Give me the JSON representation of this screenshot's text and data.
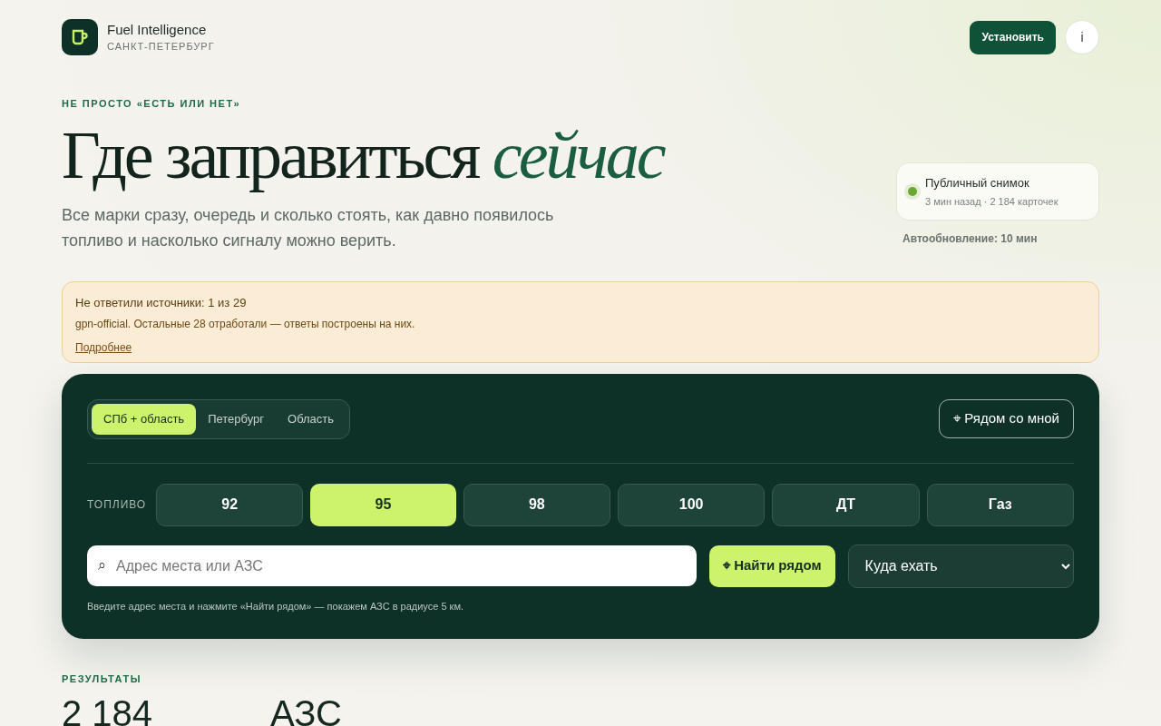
{
  "brand": {
    "name": "Fuel Intelligence",
    "city": "САНКТ-ПЕТЕРБУРГ"
  },
  "header": {
    "install_button": "Установить",
    "info_button": "i"
  },
  "hero": {
    "eyebrow": "НЕ ПРОСТО «ЕСТЬ ИЛИ НЕТ»",
    "title": "Где заправиться *сейчас*",
    "lead": "Все марки сразу, очередь и сколько стоять, как давно появилось топливо и насколько сигналу можно верить."
  },
  "snapshot": {
    "title": "Публичный снимок",
    "meta": "3 мин назад · 2 184 карточек",
    "color": "#6aa832",
    "autoupdate": "Автообновление: 10 мин"
  },
  "alert": {
    "title": "Не ответили источники: 1 из 29",
    "text": "gpn-official. Остальные 28 отработали — ответы построены на них.",
    "link": "Подробнее"
  },
  "region_tabs": [
    {
      "label": "СПб + область",
      "selected": true
    },
    {
      "label": "Петербург",
      "selected": false
    },
    {
      "label": "Область",
      "selected": false
    }
  ],
  "nearby_button": "⌖ Рядом со мной",
  "fuel": {
    "label": "ТОПЛИВО",
    "options": [
      {
        "label": "92",
        "selected": false
      },
      {
        "label": "95",
        "selected": true
      },
      {
        "label": "98",
        "selected": false
      },
      {
        "label": "100",
        "selected": false
      },
      {
        "label": "ДТ",
        "selected": false
      },
      {
        "label": "Газ",
        "selected": false
      }
    ]
  },
  "search": {
    "icon": "⌕",
    "placeholder": "Адрес места или АЗС",
    "find_button": "⌖ Найти рядом",
    "destination": "Куда ехать",
    "hint": "Введите адрес места и нажмите «Найти рядом» — покажем АЗС в радиусе 5 км."
  },
  "results": {
    "label": "РЕЗУЛЬТАТЫ",
    "count": "2 184",
    "unit": "АЗС"
  }
}
